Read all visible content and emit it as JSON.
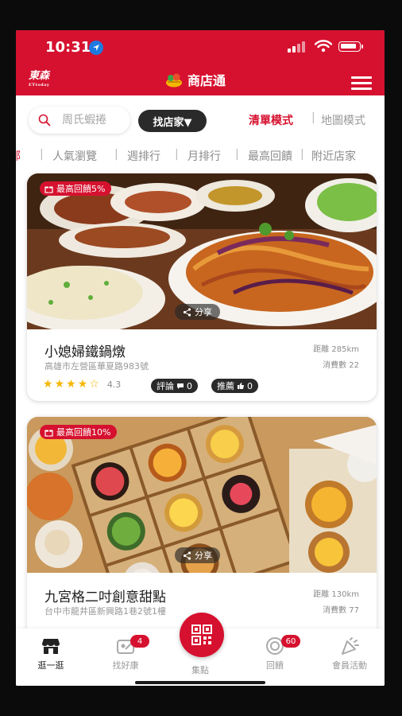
{
  "status_bar": {
    "time": "10:31"
  },
  "app_bar": {
    "left_logo": "東森",
    "left_logo_sub": "ETtoday",
    "title": "商店通"
  },
  "search": {
    "placeholder": "周氏蝦捲",
    "find_button": "找店家▼"
  },
  "view_modes": {
    "list": "清單模式",
    "separator": "|",
    "map": "地圖模式"
  },
  "tabs": [
    "全部",
    "人氣瀏覽",
    "週排行",
    "月排行",
    "最高回饋",
    "附近店家"
  ],
  "stores": [
    {
      "rebate": "最高回饋5%",
      "share": "分享",
      "name": "小媳婦鐵鍋燉",
      "address": "高雄市左營區華夏路983號",
      "distance": "距離 285km",
      "spend_count": "消費數 22",
      "rating": "4.3",
      "rating_value": 4.3,
      "reviews_label": "評論",
      "reviews_count": "0",
      "recommend_label": "推薦",
      "recommend_count": "0"
    },
    {
      "rebate": "最高回饋10%",
      "share": "分享",
      "name": "九宮格二吋創意甜點",
      "address": "台中市龍井區新興路1巷2號1樓",
      "distance": "距離 130km",
      "spend_count": "消費數 77"
    }
  ],
  "bottom_nav": [
    {
      "label": "逛一逛",
      "icon": "store-icon"
    },
    {
      "label": "找好康",
      "icon": "deals-icon",
      "badge": "4"
    },
    {
      "label": "集點",
      "icon": "qr-code-icon"
    },
    {
      "label": "回饋",
      "icon": "rebate-icon",
      "badge": "60"
    },
    {
      "label": "會員活動",
      "icon": "party-popper-icon"
    }
  ],
  "colors": {
    "brand_red": "#d6112f",
    "dark_pill": "#2a2a2a",
    "star": "#f5b700"
  }
}
